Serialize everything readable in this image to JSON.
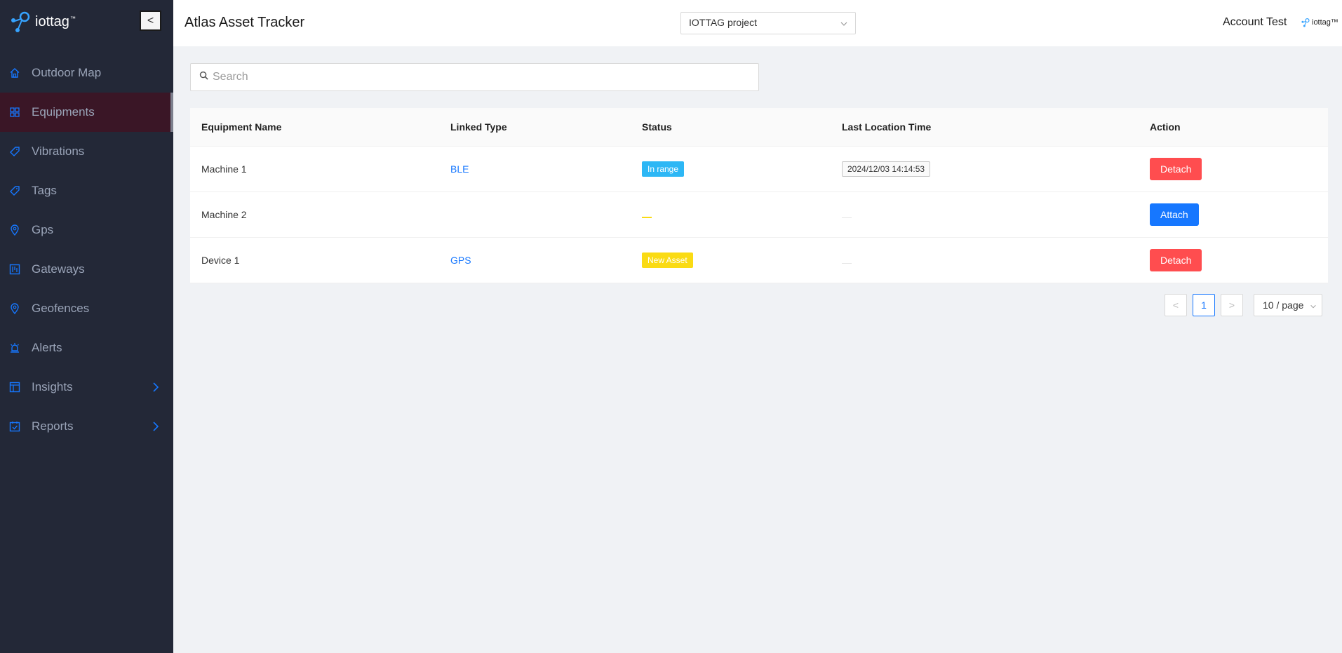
{
  "brand": {
    "name": "iottag",
    "tm": "™"
  },
  "sidebar": {
    "collapse_label": "<",
    "items": [
      {
        "label": "Outdoor Map",
        "icon": "home-icon"
      },
      {
        "label": "Equipments",
        "icon": "grid-icon",
        "active": true
      },
      {
        "label": "Vibrations",
        "icon": "tag-icon"
      },
      {
        "label": "Tags",
        "icon": "tag-icon"
      },
      {
        "label": "Gps",
        "icon": "location-pin-icon"
      },
      {
        "label": "Gateways",
        "icon": "gateway-icon"
      },
      {
        "label": "Geofences",
        "icon": "location-pin-icon"
      },
      {
        "label": "Alerts",
        "icon": "alarm-icon"
      },
      {
        "label": "Insights",
        "icon": "dashboard-icon",
        "expandable": true
      },
      {
        "label": "Reports",
        "icon": "calendar-check-icon",
        "expandable": true
      }
    ]
  },
  "header": {
    "title": "Atlas Asset Tracker",
    "project": "IOTTAG project",
    "account": "Account Test",
    "logo_text": "iottag™"
  },
  "search": {
    "placeholder": "Search"
  },
  "table": {
    "columns": [
      "Equipment Name",
      "Linked Type",
      "Status",
      "Last Location Time",
      "Action"
    ],
    "rows": [
      {
        "name": "Machine 1",
        "linked_type": "BLE",
        "status": "In range",
        "last_location_time": "2024/12/03 14:14:53",
        "action": "Detach"
      },
      {
        "name": "Machine 2",
        "linked_type": "",
        "status": "",
        "last_location_time": "",
        "action": "Attach"
      },
      {
        "name": "Device 1",
        "linked_type": "GPS",
        "status": "New Asset",
        "last_location_time": "",
        "action": "Detach"
      }
    ]
  },
  "pagination": {
    "prev": "<",
    "current": "1",
    "next": ">",
    "page_size": "10 / page"
  },
  "colors": {
    "sidebar_bg": "#232837",
    "active_item_bg": "#3a1626",
    "accent": "#1677ff",
    "danger": "#ff4d4f",
    "status_in_range": "#2db7f5",
    "status_new_asset": "#fadb14"
  }
}
